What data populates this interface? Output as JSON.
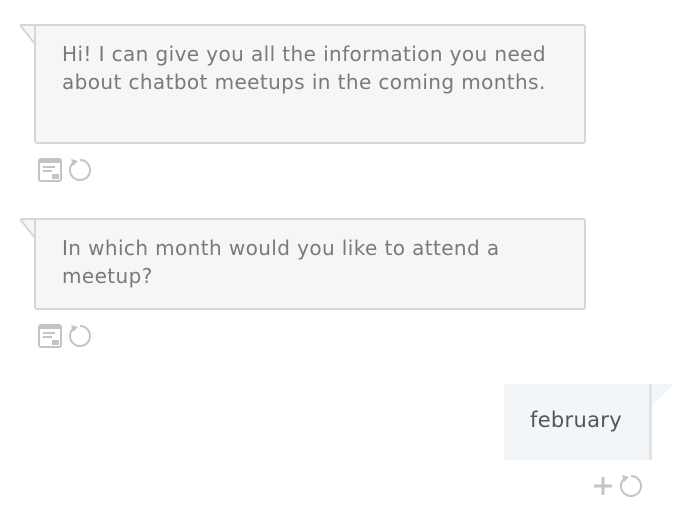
{
  "messages": [
    {
      "sender": "bot",
      "text": "Hi! I can give you all the information you need about chatbot meetups in the coming months."
    },
    {
      "sender": "bot",
      "text": "In which month would you like to attend a meetup?"
    },
    {
      "sender": "user",
      "text": "february"
    }
  ],
  "icons": {
    "bot_actions": [
      "card-view-icon",
      "refresh-icon"
    ],
    "user_actions": [
      "plus-icon",
      "refresh-icon"
    ]
  },
  "colors": {
    "bot_bubble_bg": "#f6f6f6",
    "bot_bubble_border": "#d6d6d6",
    "bot_text": "#7a7a7a",
    "user_bubble_bg": "#f3f6f9",
    "user_text": "#555555",
    "icon_gray": "#c4c4c4"
  }
}
